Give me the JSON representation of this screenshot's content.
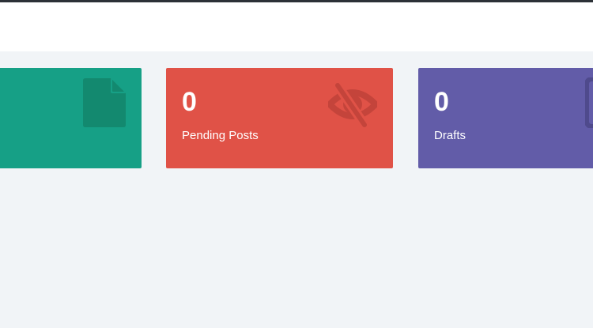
{
  "stats": {
    "pending_posts": {
      "count": "0",
      "label": "Pending Posts"
    },
    "drafts": {
      "count": "0",
      "label": "Drafts"
    }
  },
  "colors": {
    "published_card": "#16a086",
    "pending_card": "#e05247",
    "drafts_card": "#625ca8",
    "page_background": "#f1f4f7"
  },
  "icons": {
    "published": "document-icon",
    "pending": "eye-slash-icon",
    "drafts": "edit-icon"
  }
}
